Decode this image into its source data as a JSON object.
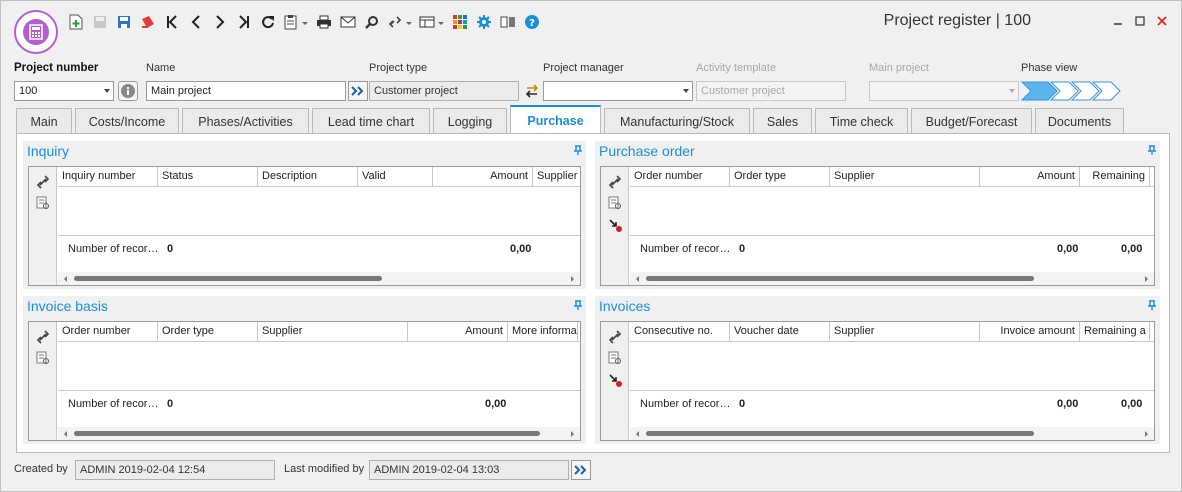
{
  "window": {
    "title": "Project register | 100",
    "controls": [
      "minimize-icon",
      "maximize-icon",
      "close-icon"
    ]
  },
  "toolbar": {
    "icons": [
      "new-record-icon",
      "save-disabled-icon",
      "save-icon",
      "delete-icon",
      "first-record-icon",
      "previous-record-icon",
      "next-record-icon",
      "last-record-icon",
      "refresh-icon",
      "clipboard-icon",
      "print-icon",
      "email-icon",
      "search-icon",
      "link-icon",
      "layout-icon",
      "colors-icon",
      "settings-icon",
      "books-icon",
      "help-icon"
    ]
  },
  "header": {
    "project_number": {
      "label": "Project number",
      "value": "100"
    },
    "name": {
      "label": "Name",
      "value": "Main project"
    },
    "project_type": {
      "label": "Project type",
      "value": "Customer project"
    },
    "project_manager": {
      "label": "Project manager",
      "value": ""
    },
    "activity_template": {
      "label": "Activity template",
      "value": "Customer project"
    },
    "main_project": {
      "label": "Main project",
      "value": ""
    },
    "phase_view": {
      "label": "Phase view",
      "phase_count": 4
    }
  },
  "tabs": [
    {
      "label": "Main",
      "active": false
    },
    {
      "label": "Costs/Income",
      "active": false
    },
    {
      "label": "Phases/Activities",
      "active": false
    },
    {
      "label": "Lead time chart",
      "active": false
    },
    {
      "label": "Logging",
      "active": false
    },
    {
      "label": "Purchase",
      "active": true
    },
    {
      "label": "Manufacturing/Stock",
      "active": false
    },
    {
      "label": "Sales",
      "active": false
    },
    {
      "label": "Time check",
      "active": false
    },
    {
      "label": "Budget/Forecast",
      "active": false
    },
    {
      "label": "Documents",
      "active": false
    }
  ],
  "panels": {
    "inquiry": {
      "title": "Inquiry",
      "columns": [
        "Inquiry number",
        "Status",
        "Description",
        "Valid",
        "Amount",
        "Supplier"
      ],
      "footer_label": "Number of recor…",
      "count": "0",
      "amount_total": "0,00"
    },
    "purchase_order": {
      "title": "Purchase order",
      "columns": [
        "Order number",
        "Order type",
        "Supplier",
        "Amount",
        "Remaining"
      ],
      "footer_label": "Number of recor…",
      "count": "0",
      "amount_total": "0,00",
      "remaining_total": "0,00"
    },
    "invoice_basis": {
      "title": "Invoice basis",
      "columns": [
        "Order number",
        "Order type",
        "Supplier",
        "Amount",
        "More informa"
      ],
      "footer_label": "Number of recor…",
      "count": "0",
      "amount_total": "0,00"
    },
    "invoices": {
      "title": "Invoices",
      "columns": [
        "Consecutive no.",
        "Voucher date",
        "Supplier",
        "Invoice amount",
        "Remaining a"
      ],
      "footer_label": "Number of recor…",
      "count": "0",
      "amount_total": "0,00",
      "remaining_total": "0,00"
    }
  },
  "footer": {
    "created_by_label": "Created by",
    "created_by_value": "ADMIN 2019-02-04 12:54",
    "modified_label": "Last modified by",
    "modified_value": "ADMIN 2019-02-04 13:03"
  },
  "colors": {
    "accent": "#1a8fd8",
    "app_badge": "#b35fd0",
    "phase_arrow": "#5bb4ec"
  }
}
